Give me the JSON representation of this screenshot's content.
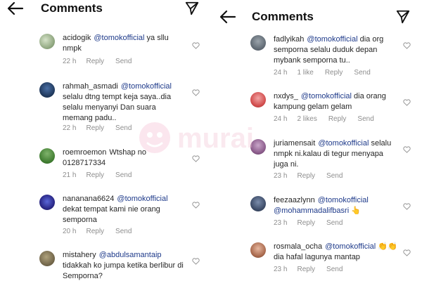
{
  "colors": {
    "text": "#262626",
    "mention": "#1e3a8a",
    "meta": "#8e8e8e",
    "accent": "#111111"
  },
  "left": {
    "title": "Comments",
    "comments": [
      {
        "user": "acidogik",
        "mention": "@tomokofficial",
        "text": "ya sllu nmpk",
        "time": "22 h",
        "reply": "Reply",
        "send": "Send"
      },
      {
        "user": "rahmah_asmadi",
        "mention": "@tomokofficial",
        "text": "selalu dtng tempt keja saya..dia selalu menyanyi Dan suara memang padu..",
        "time": "22 h",
        "reply": "Reply",
        "send": "Send"
      },
      {
        "user": "roemroemon",
        "mention": "",
        "text": "Wtshap no 0128717334",
        "time": "21 h",
        "reply": "Reply",
        "send": "Send"
      },
      {
        "user": "nananana6624",
        "mention": "@tomokofficial",
        "text": "dekat tempat kami nie orang semporna",
        "time": "20 h",
        "reply": "Reply",
        "send": "Send"
      },
      {
        "user": "mistahery",
        "mention": "@abdulsamantaip",
        "text": "tidakkah ko jumpa ketika berlibur di Semporna?",
        "time": "",
        "reply": "",
        "send": ""
      }
    ]
  },
  "right": {
    "title": "Comments",
    "comments": [
      {
        "user": "fadlyikah",
        "mention": "@tomokofficial",
        "text": "dia org semporna selalu duduk depan mybank semporna tu..",
        "time": "24 h",
        "likes": "1 like",
        "reply": "Reply",
        "send": "Send"
      },
      {
        "user": "nxdys_",
        "mention": "@tomokofficial",
        "text": "dia orang kampung gelam gelam",
        "time": "24 h",
        "likes": "2 likes",
        "reply": "Reply",
        "send": "Send"
      },
      {
        "user": "juriamensait",
        "mention": "@tomokofficial",
        "text": "selalu nmpk ni.kalau di tegur menyapa juga ni.",
        "time": "23 h",
        "likes": "",
        "reply": "Reply",
        "send": "Send"
      },
      {
        "user": "feezaazlynn",
        "mention": "@tomokofficial",
        "text": "@mohammadalifbasri 👆",
        "time": "23 h",
        "likes": "",
        "reply": "Reply",
        "send": "Send"
      },
      {
        "user": "rosmala_ocha",
        "mention": "@tomokofficial",
        "text": "👏👏 dia hafal lagunya mantap",
        "time": "23 h",
        "likes": "",
        "reply": "Reply",
        "send": "Send"
      }
    ]
  },
  "watermark": {
    "text": "murai"
  },
  "icons": {
    "back": "arrow-left-icon",
    "share": "paper-plane-icon",
    "like": "heart-icon"
  }
}
